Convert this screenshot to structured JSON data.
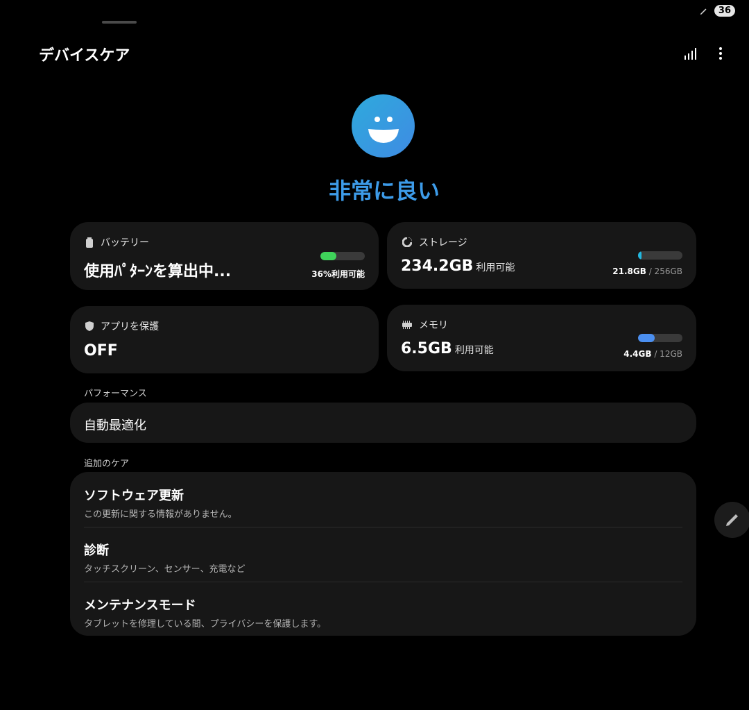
{
  "status_bar": {
    "pen_icon": "pen-icon",
    "badge": "36"
  },
  "app_title": "デバイスケア",
  "toolbar": {
    "chart_icon": "bar-chart-icon",
    "more_icon": "more-vertical-icon"
  },
  "status": {
    "face_icon": "smiley-face-icon",
    "label": "非常に良い"
  },
  "battery": {
    "title": "バッテリー",
    "main": "使用ﾊﾟﾀｰﾝを算出中...",
    "percent_label": "36%利用可能",
    "fill_fraction": 0.36,
    "color": "#3fd35a"
  },
  "storage": {
    "title": "ストレージ",
    "value": "234.2GB",
    "unit": "利用可能",
    "used": "21.8GB",
    "total": "/ 256GB",
    "fill_fraction": 0.085,
    "color": "#22b8e0"
  },
  "app_protection": {
    "title": "アプリを保護",
    "value": "OFF"
  },
  "memory": {
    "title": "メモリ",
    "value": "6.5GB",
    "unit": "利用可能",
    "used": "4.4GB",
    "total": "/ 12GB",
    "fill_fraction": 0.37,
    "color": "#4b8ff0"
  },
  "performance": {
    "section_label": "パフォーマンス",
    "item": "自動最適化"
  },
  "additional_care": {
    "section_label": "追加のケア",
    "items": [
      {
        "title": "ソフトウェア更新",
        "subtitle": "この更新に関する情報がありません。"
      },
      {
        "title": "診断",
        "subtitle": "タッチスクリーン、センサー、充電など"
      },
      {
        "title": "メンテナンスモード",
        "subtitle": "タブレットを修理している間、プライバシーを保護します。"
      }
    ]
  },
  "fab": {
    "icon": "edit-pen-icon"
  }
}
